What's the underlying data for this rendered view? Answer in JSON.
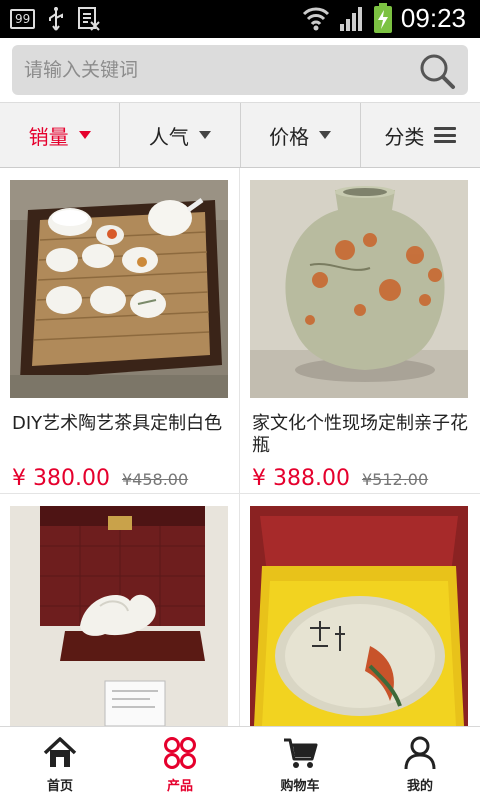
{
  "status_bar": {
    "notification_badge": "99",
    "time": "09:23"
  },
  "search": {
    "placeholder": "请输入关键词"
  },
  "filters": [
    {
      "label": "销量",
      "active": true
    },
    {
      "label": "人气",
      "active": false
    },
    {
      "label": "价格",
      "active": false
    },
    {
      "label": "分类",
      "active": false
    }
  ],
  "products": [
    {
      "title": "DIY艺术陶艺茶具定制白色",
      "price": "¥ 380.00",
      "old_price": "¥458.00",
      "image": "tea-set-photo"
    },
    {
      "title": "家文化个性现场定制亲子花瓶",
      "price": "¥ 388.00",
      "old_price": "¥512.00",
      "image": "vase-photo"
    },
    {
      "title": "",
      "price": "",
      "old_price": "",
      "image": "jade-carving-photo"
    },
    {
      "title": "",
      "price": "",
      "old_price": "",
      "image": "fish-plate-photo"
    }
  ],
  "tabbar": [
    {
      "label": "首页",
      "icon": "home-icon",
      "active": false
    },
    {
      "label": "产品",
      "icon": "products-icon",
      "active": true
    },
    {
      "label": "购物车",
      "icon": "cart-icon",
      "active": false
    },
    {
      "label": "我的",
      "icon": "user-icon",
      "active": false
    }
  ],
  "colors": {
    "accent": "#e5002d",
    "statusbar_bg": "#000000",
    "search_bg": "#dcdcdc"
  }
}
